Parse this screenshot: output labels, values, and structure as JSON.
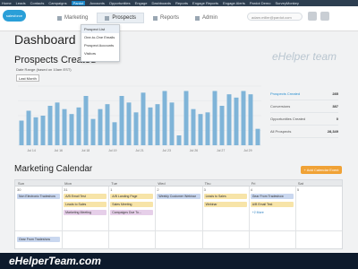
{
  "topnav": [
    "Home",
    "Leads",
    "Contacts",
    "Campaigns",
    "Pardot",
    "Accounts",
    "Opportunities",
    "Engage",
    "Dashboards",
    "Reports",
    "Engage Reports",
    "Engage Alerts",
    "Pardot Demo",
    "SurveyMonkey"
  ],
  "topnav_active": "Pardot",
  "logo_text": "salesforce",
  "apptabs": [
    {
      "label": "Marketing",
      "active": false
    },
    {
      "label": "Prospects",
      "active": true
    },
    {
      "label": "Reports",
      "active": false
    },
    {
      "label": "Admin",
      "active": false
    }
  ],
  "user_box": "adam.miller@pardot.com",
  "dropdown": [
    "Prospect List",
    "One-to-One Emails",
    "Prospect Accounts",
    "Visitors"
  ],
  "page_title": "Dashboard",
  "section_title": "Prospects Created",
  "date_range_label": "Date Range (based on 10am EST)",
  "date_select": "Last Month",
  "chart_data": {
    "type": "bar",
    "title": "",
    "x_tick_labels": [
      "Jul 14",
      "Jul 16",
      "Jul 18",
      "Jul 19",
      "Jul 21",
      "Jul 23",
      "Jul 26",
      "Jul 27",
      "Jul 29"
    ],
    "values": [
      1.5,
      2.1,
      1.7,
      1.8,
      2.4,
      2.6,
      2.2,
      1.9,
      2.3,
      3.0,
      1.6,
      2.2,
      2.5,
      1.4,
      3.0,
      2.6,
      2.0,
      3.2,
      2.3,
      2.5,
      3.3,
      2.6,
      0.6,
      3.3,
      2.2,
      1.9,
      2.0,
      3.3,
      2.4,
      3.1,
      2.9,
      3.3,
      3.1,
      1.0
    ],
    "ylim": [
      0,
      3.6
    ],
    "bar_color": "#7fb4d8",
    "grid": true
  },
  "stats": [
    {
      "label": "Prospects Created",
      "value": "285"
    },
    {
      "label": "Conversions",
      "value": "387"
    },
    {
      "label": "Opportunities Created",
      "value": "0"
    },
    {
      "label": "All Prospects",
      "value": "28,349"
    }
  ],
  "calendar_title": "Marketing Calendar",
  "add_button": "+ Add Calendar Event",
  "days": [
    "Sun",
    "Mon",
    "Tue",
    "Wed",
    "Thu",
    "Fri",
    "Sat"
  ],
  "day_numbers": [
    "30",
    "31",
    "1",
    "2",
    "3",
    "4",
    "5"
  ],
  "events": [
    {
      "col": 0,
      "row": 0,
      "text": "Non Electronic Tradeshow",
      "color": "#c9d7ef"
    },
    {
      "col": 1,
      "row": 0,
      "text": "A/B Email Test",
      "color": "#f7e4a8"
    },
    {
      "col": 1,
      "row": 1,
      "text": "Leads to Sales",
      "color": "#f7e4a8"
    },
    {
      "col": 1,
      "row": 2,
      "text": "Marketing Meeting",
      "color": "#e6cfe9"
    },
    {
      "col": 2,
      "row": 0,
      "text": "A/B Landing Page",
      "color": "#f7e4a8"
    },
    {
      "col": 2,
      "row": 1,
      "text": "Sales Meeting",
      "color": "#f7e4a8"
    },
    {
      "col": 2,
      "row": 2,
      "text": "Campaigns Due To...",
      "color": "#e6cfe9"
    },
    {
      "col": 3,
      "row": 0,
      "text": "Weekly Customer Webinar",
      "color": "#c9d7ef"
    },
    {
      "col": 4,
      "row": 0,
      "text": "Leads to Sales",
      "color": "#f7e4a8"
    },
    {
      "col": 4,
      "row": 1,
      "text": "Webinar",
      "color": "#f7e4a8"
    },
    {
      "col": 5,
      "row": 0,
      "text": "Gear From Tradeshow",
      "color": "#c9d7ef"
    },
    {
      "col": 5,
      "row": 1,
      "text": "A/B Email Test",
      "color": "#f7e4a8"
    },
    {
      "col": 5,
      "row": 2,
      "text": "+2 More",
      "color": "#ffffff"
    }
  ],
  "next_week_event": "Gear From Tradeshow",
  "watermark": "eHelper team",
  "footer_brand": "eHelperTeam.com"
}
